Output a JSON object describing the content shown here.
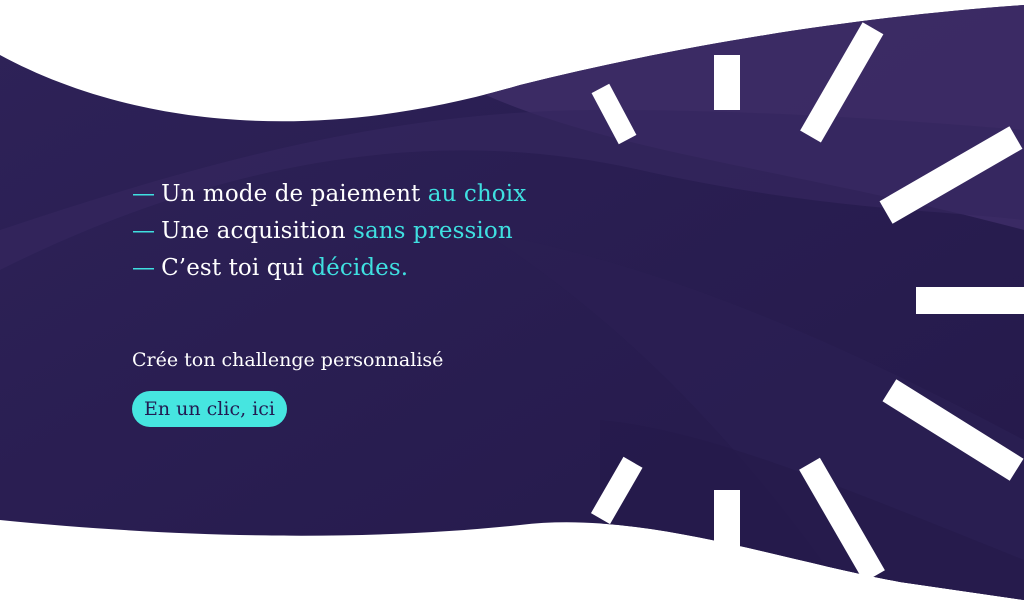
{
  "features": [
    {
      "dash": "—",
      "text": "Un mode de paiement ",
      "highlight": "au choix"
    },
    {
      "dash": "—",
      "text": "Une acquisition ",
      "highlight": "sans pression"
    },
    {
      "dash": "—",
      "text": "C’est toi qui ",
      "highlight": "décides."
    }
  ],
  "cta": {
    "title": "Crée ton challenge personnalisé",
    "button_label": "En un clic, ici"
  },
  "colors": {
    "banner_dark": "#2a1f54",
    "banner_light": "#3f2d66",
    "accent": "#3fe0e0",
    "button_bg": "#46e5e0",
    "text": "#ffffff"
  }
}
